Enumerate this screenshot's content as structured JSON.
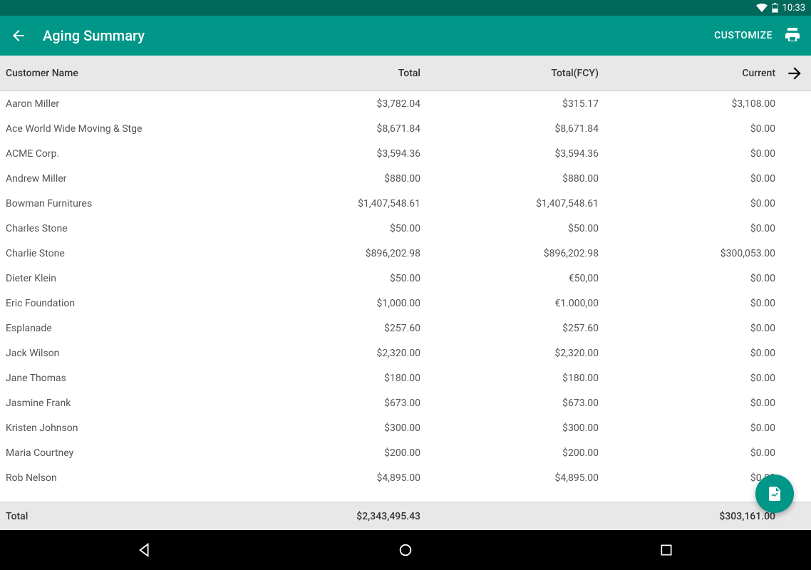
{
  "status": {
    "time": "10:33"
  },
  "appbar": {
    "title": "Aging Summary",
    "customize": "CUSTOMIZE"
  },
  "table": {
    "headers": {
      "name": "Customer Name",
      "total": "Total",
      "fcy": "Total(FCY)",
      "current": "Current"
    },
    "rows": [
      {
        "name": "Aaron Miller",
        "total": "$3,782.04",
        "fcy": "$315.17",
        "current": "$3,108.00"
      },
      {
        "name": "Ace World Wide Moving & Stge",
        "total": "$8,671.84",
        "fcy": "$8,671.84",
        "current": "$0.00"
      },
      {
        "name": "ACME Corp.",
        "total": "$3,594.36",
        "fcy": "$3,594.36",
        "current": "$0.00"
      },
      {
        "name": "Andrew Miller",
        "total": "$880.00",
        "fcy": "$880.00",
        "current": "$0.00"
      },
      {
        "name": "Bowman Furnitures",
        "total": "$1,407,548.61",
        "fcy": "$1,407,548.61",
        "current": "$0.00"
      },
      {
        "name": "Charles Stone",
        "total": "$50.00",
        "fcy": "$50.00",
        "current": "$0.00"
      },
      {
        "name": "Charlie Stone",
        "total": "$896,202.98",
        "fcy": "$896,202.98",
        "current": "$300,053.00"
      },
      {
        "name": "Dieter Klein",
        "total": "$50.00",
        "fcy": "€50,00",
        "current": "$0.00"
      },
      {
        "name": "Eric Foundation",
        "total": "$1,000.00",
        "fcy": "€1.000,00",
        "current": "$0.00"
      },
      {
        "name": "Esplanade",
        "total": "$257.60",
        "fcy": "$257.60",
        "current": "$0.00"
      },
      {
        "name": "Jack Wilson",
        "total": "$2,320.00",
        "fcy": "$2,320.00",
        "current": "$0.00"
      },
      {
        "name": "Jane Thomas",
        "total": "$180.00",
        "fcy": "$180.00",
        "current": "$0.00"
      },
      {
        "name": "Jasmine Frank",
        "total": "$673.00",
        "fcy": "$673.00",
        "current": "$0.00"
      },
      {
        "name": "Kristen Johnson",
        "total": "$300.00",
        "fcy": "$300.00",
        "current": "$0.00"
      },
      {
        "name": "Maria Courtney",
        "total": "$200.00",
        "fcy": "$200.00",
        "current": "$0.00"
      },
      {
        "name": "Rob Nelson",
        "total": "$4,895.00",
        "fcy": "$4,895.00",
        "current": "$0.00"
      }
    ],
    "footer": {
      "label": "Total",
      "total": "$2,343,495.43",
      "current": "$303,161.00"
    }
  }
}
